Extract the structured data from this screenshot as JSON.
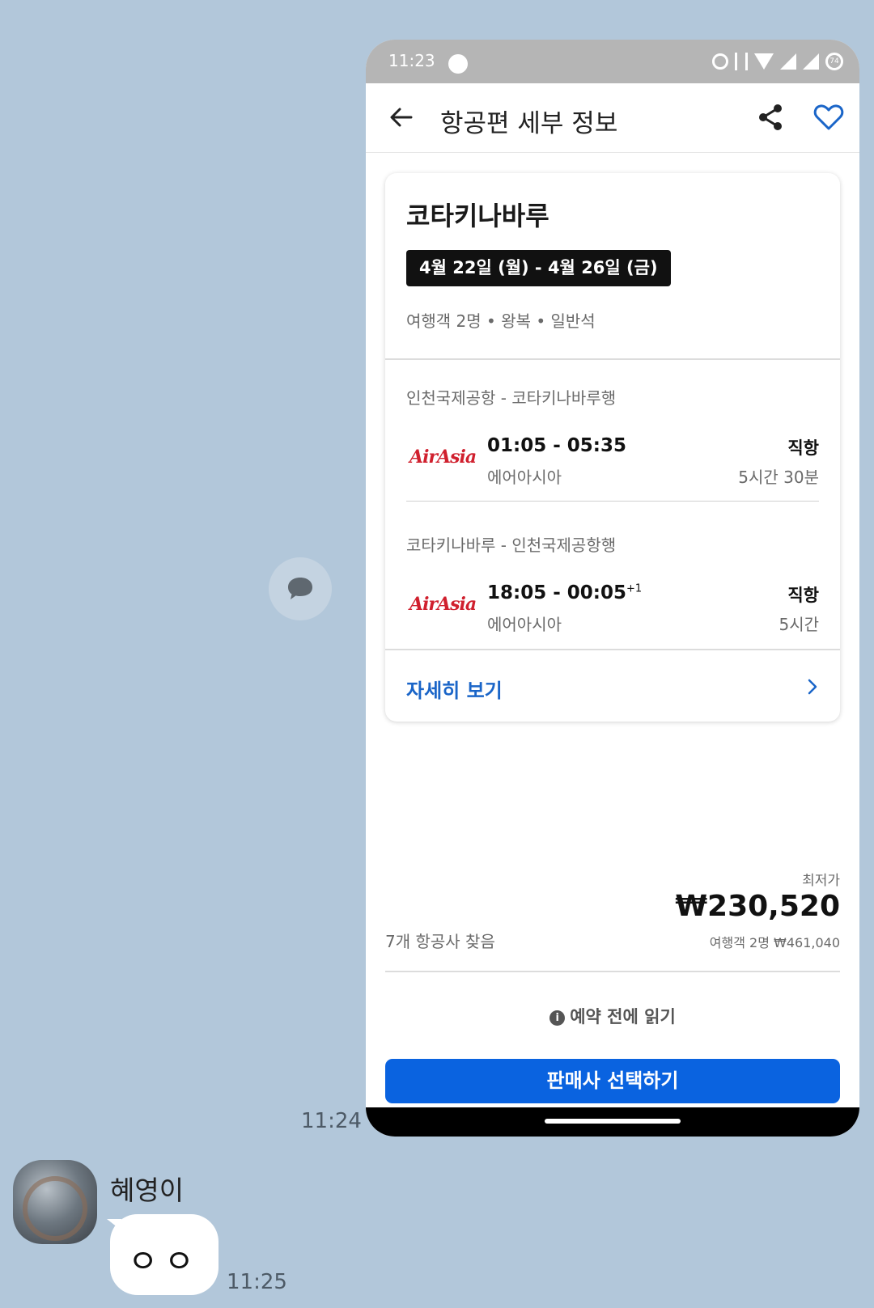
{
  "chat": {
    "forward_time": "11:24",
    "sender_name": "혜영이",
    "message": "ㅇㅇ",
    "message_time": "11:25"
  },
  "phone": {
    "status_time": "11:23",
    "battery": "74"
  },
  "appbar": {
    "title": "항공편 세부 정보"
  },
  "trip": {
    "destination": "코타키나바루",
    "dates": "4월 22일 (월) - 4월 26일 (금)",
    "meta": "여행객 2명 • 왕복 • 일반석",
    "segments": [
      {
        "route": "인천국제공항 - 코타키나바루행",
        "airline_logo": "AirAsia",
        "times": "01:05 - 05:35",
        "day_offset": "",
        "airline": "에어아시아",
        "stops": "직항",
        "duration": "5시간 30분"
      },
      {
        "route": "코타키나바루 - 인천국제공항행",
        "airline_logo": "AirAsia",
        "times": "18:05 - 00:05",
        "day_offset": "+1",
        "airline": "에어아시아",
        "stops": "직항",
        "duration": "5시간"
      }
    ],
    "more_label": "자세히 보기"
  },
  "pricing": {
    "low_label": "최저가",
    "price": "₩230,520",
    "total": "여행객 2명 ₩461,040",
    "found": "7개 항공사 찾음"
  },
  "readme_label": "예약 전에 읽기",
  "cta_label": "판매사 선택하기",
  "colors": {
    "chat_bg": "#b2c7da",
    "accent": "#0a63e0",
    "link": "#1a65c8",
    "airasia_red": "#d0202e"
  }
}
